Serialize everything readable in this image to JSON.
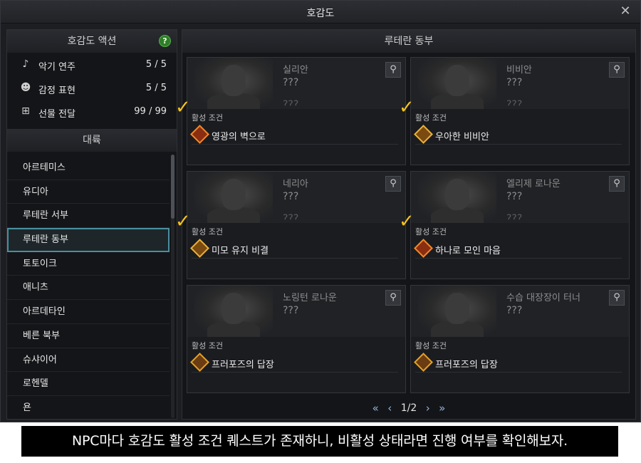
{
  "window": {
    "title": "호감도",
    "close_icon": "close-icon"
  },
  "actions": {
    "header": "호감도 액션",
    "items": [
      {
        "icon": "music-note-icon",
        "label": "악기 연주",
        "value": "5 / 5"
      },
      {
        "icon": "emote-icon",
        "label": "감정 표현",
        "value": "5 / 5"
      },
      {
        "icon": "gift-icon",
        "label": "선물 전달",
        "value": "99 / 99"
      }
    ]
  },
  "continents": {
    "header": "대륙",
    "items": [
      "아르테미스",
      "유디아",
      "루테란 서부",
      "루테란 동부",
      "토토이크",
      "애니츠",
      "아르데타인",
      "베른 북부",
      "슈샤이어",
      "로헨델",
      "욘"
    ],
    "selected": "루테란 동부"
  },
  "main": {
    "header": "루테란 동부",
    "cond_label": "활성 조건",
    "npcs": [
      {
        "name": "실리안",
        "hidden1": "???",
        "hidden2": "???",
        "condition": "영광의 벽으로",
        "checked": true
      },
      {
        "name": "비비안",
        "hidden1": "???",
        "hidden2": "???",
        "condition": "우아한 비비안",
        "checked": true
      },
      {
        "name": "네리아",
        "hidden1": "???",
        "hidden2": "???",
        "condition": "미모 유지 비결",
        "checked": true
      },
      {
        "name": "엘리제 로나운",
        "hidden1": "???",
        "hidden2": "???",
        "condition": "하나로 모인 마음",
        "checked": true
      },
      {
        "name": "노링턴 로나운",
        "hidden1": "???",
        "hidden2": "",
        "condition": "프러포즈의 답장",
        "checked": false
      },
      {
        "name": "수습 대장장이 터너",
        "hidden1": "???",
        "hidden2": "",
        "condition": "프러포즈의 답장",
        "checked": false
      }
    ],
    "pager": {
      "first": "«",
      "prev": "‹",
      "page": "1/2",
      "next": "›",
      "last": "»"
    }
  },
  "caption": "NPC마다 호감도 활성 조건 퀘스트가 존재하니, 비활성 상태라면 진행 여부를 확인해보자."
}
